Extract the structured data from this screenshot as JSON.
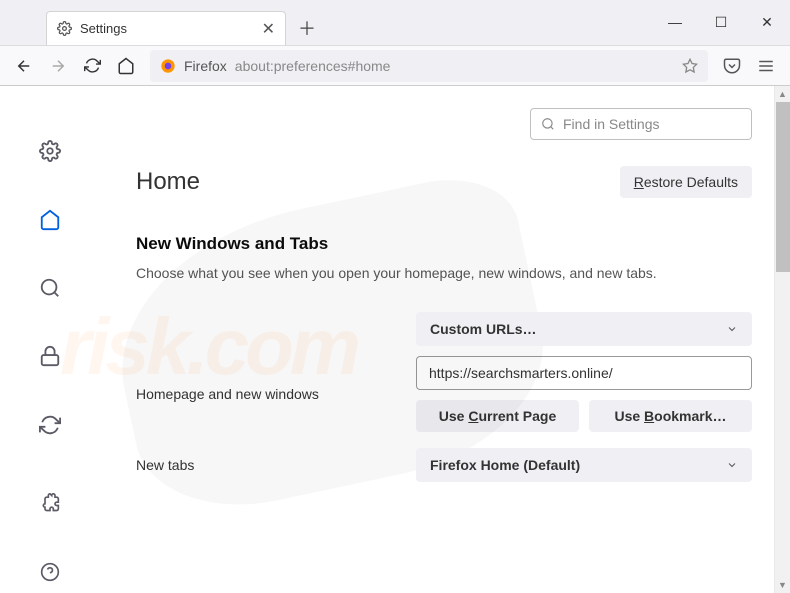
{
  "tab": {
    "title": "Settings"
  },
  "urlbar": {
    "label": "Firefox",
    "path": "about:preferences#home"
  },
  "window": {
    "min": "—",
    "max": "☐",
    "close": "✕"
  },
  "search": {
    "placeholder": "Find in Settings"
  },
  "page": {
    "title": "Home",
    "restore": "Restore Defaults",
    "section_title": "New Windows and Tabs",
    "description": "Choose what you see when you open your homepage, new windows, and new tabs."
  },
  "homepage": {
    "label": "Homepage and new windows",
    "select": "Custom URLs…",
    "url": "https://searchsmarters.online/",
    "btn_current": "Use Current Page",
    "btn_bookmark": "Use Bookmark…"
  },
  "newtabs": {
    "label": "New tabs",
    "select": "Firefox Home (Default)"
  }
}
